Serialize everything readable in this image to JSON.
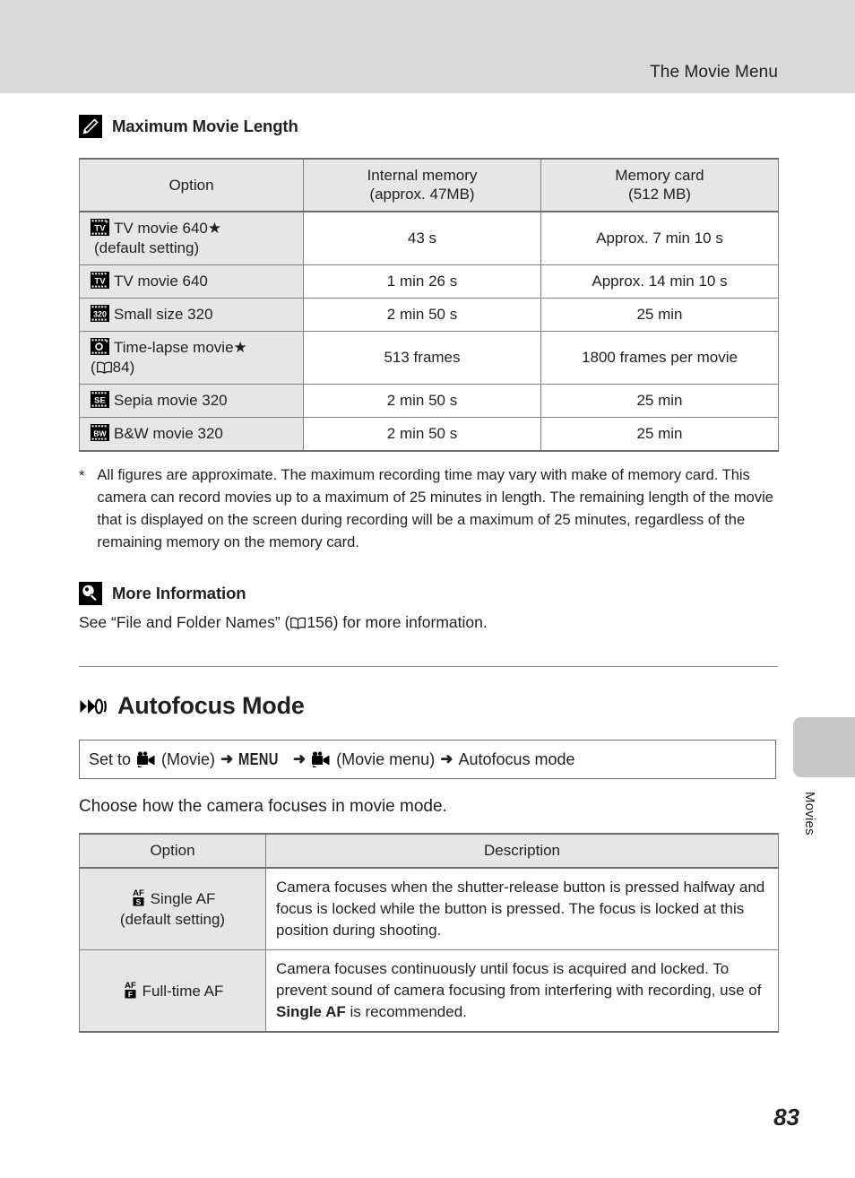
{
  "header": {
    "title": "The Movie Menu"
  },
  "note_max_length": {
    "icon": "pencil-note-icon",
    "title": "Maximum Movie Length",
    "table": {
      "headers": [
        "Option",
        "Internal memory\n(approx. 47MB)",
        "Memory card\n(512 MB)"
      ],
      "header_internal_line1": "Internal memory",
      "header_internal_line2": "(approx. 47MB)",
      "header_card_line1": "Memory card",
      "header_card_line2": "(512 MB)",
      "rows": [
        {
          "icon": "film-tv-star-icon",
          "icon_label": "TV",
          "option_line1": "TV movie 640",
          "option_star": "★",
          "option_line2": "(default setting)",
          "internal": "43 s",
          "card": "Approx. 7 min 10 s"
        },
        {
          "icon": "film-tv-icon",
          "icon_label": "TV",
          "option_line1": "TV movie 640",
          "option_star": "",
          "option_line2": "",
          "internal": "1 min 26 s",
          "card": "Approx. 14 min 10 s"
        },
        {
          "icon": "film-320-icon",
          "icon_label": "320",
          "option_line1": "Small size 320",
          "option_star": "",
          "option_line2": "",
          "internal": "2 min 50 s",
          "card": "25 min"
        },
        {
          "icon": "film-timelapse-icon",
          "icon_label": "",
          "option_line1": "Time-lapse movie",
          "option_star": "★",
          "option_line2_prefix": "(",
          "option_line2_ref": "84",
          "option_line2_suffix": ")",
          "internal": "513 frames",
          "card": "1800 frames per movie"
        },
        {
          "icon": "film-sepia-icon",
          "icon_label": "SE",
          "option_line1": "Sepia movie 320",
          "option_star": "",
          "option_line2": "",
          "internal": "2 min 50 s",
          "card": "25 min"
        },
        {
          "icon": "film-bw-icon",
          "icon_label": "BW",
          "option_line1": "B&W movie 320",
          "option_star": "",
          "option_line2": "",
          "internal": "2 min 50 s",
          "card": "25 min"
        }
      ]
    },
    "footnote_marker": "*",
    "footnote": "All figures are approximate. The maximum recording time may vary with make of memory card. This camera can record movies up to a maximum of 25 minutes in length. The remaining length of the movie that is displayed on the screen during recording will be a maximum of 25 minutes, regardless of the remaining memory on the memory card."
  },
  "note_more_information": {
    "icon": "lightbulb-note-icon",
    "title": "More Information",
    "text_before": "See “File and Folder Names” (",
    "reference": "156",
    "text_after": ") for more information."
  },
  "section_autofocus": {
    "icon": "autofocus-mode-icon",
    "title": "Autofocus Mode",
    "path": {
      "set_to": "Set to",
      "movie_label_1": "(Movie)",
      "menu_label": "MENU",
      "movie_label_2": "(Movie menu)",
      "destination": "Autofocus mode",
      "arrow": "➜"
    },
    "intro": "Choose how the camera focuses in movie mode.",
    "table": {
      "headers": [
        "Option",
        "Description"
      ],
      "rows": [
        {
          "icon": "af-single-icon",
          "option_line1": "Single AF",
          "option_line2": "(default setting)",
          "description": "Camera focuses when the shutter-release button is pressed halfway and focus is locked while the button is pressed. The focus is locked at this position during shooting."
        },
        {
          "icon": "af-fulltime-icon",
          "option_line1": "Full-time AF",
          "option_line2": "",
          "description_part1": "Camera focuses continuously until focus is acquired and locked. To prevent sound of camera focusing from interfering with recording, use of ",
          "description_bold": "Single AF",
          "description_part2": " is recommended."
        }
      ]
    }
  },
  "side_tab": {
    "label": "Movies"
  },
  "page_number": "83"
}
